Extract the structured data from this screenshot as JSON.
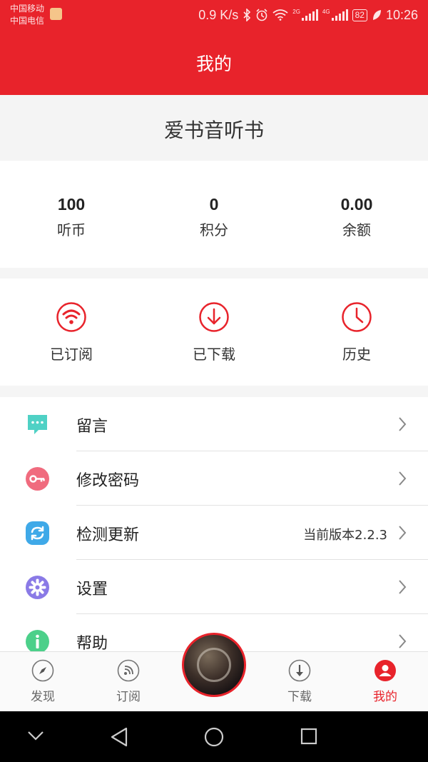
{
  "status_bar": {
    "carrier1": "中国移动",
    "carrier2": "中国电信",
    "speed": "0.9 K/s",
    "net1": "2G",
    "net2": "4G",
    "battery": "82",
    "time": "10:26"
  },
  "header": {
    "title": "我的"
  },
  "app": {
    "name": "爱书音听书"
  },
  "stats": [
    {
      "value": "100",
      "label": "听币"
    },
    {
      "value": "0",
      "label": "积分"
    },
    {
      "value": "0.00",
      "label": "余额"
    }
  ],
  "shortcuts": [
    {
      "label": "已订阅",
      "icon": "subscribe-wifi-icon"
    },
    {
      "label": "已下载",
      "icon": "download-circle-icon"
    },
    {
      "label": "历史",
      "icon": "clock-icon"
    }
  ],
  "menu": [
    {
      "label": "留言",
      "icon": "message-icon",
      "extra": ""
    },
    {
      "label": "修改密码",
      "icon": "key-icon",
      "extra": ""
    },
    {
      "label": "检测更新",
      "icon": "refresh-icon",
      "extra": "当前版本2.2.3"
    },
    {
      "label": "设置",
      "icon": "gear-icon",
      "extra": ""
    },
    {
      "label": "帮助",
      "icon": "info-icon",
      "extra": ""
    }
  ],
  "tabs": [
    {
      "label": "发现",
      "icon": "compass-icon"
    },
    {
      "label": "订阅",
      "icon": "rss-icon"
    },
    {
      "label": "下载",
      "icon": "download-icon"
    },
    {
      "label": "我的",
      "icon": "user-icon"
    }
  ],
  "colors": {
    "brand": "#e8232b",
    "message_icon": "#4fd1c5",
    "key_icon": "#f06b7e",
    "refresh_icon": "#3fa9e8",
    "gear_icon": "#8a7ae6",
    "info_icon": "#4cd08a"
  }
}
